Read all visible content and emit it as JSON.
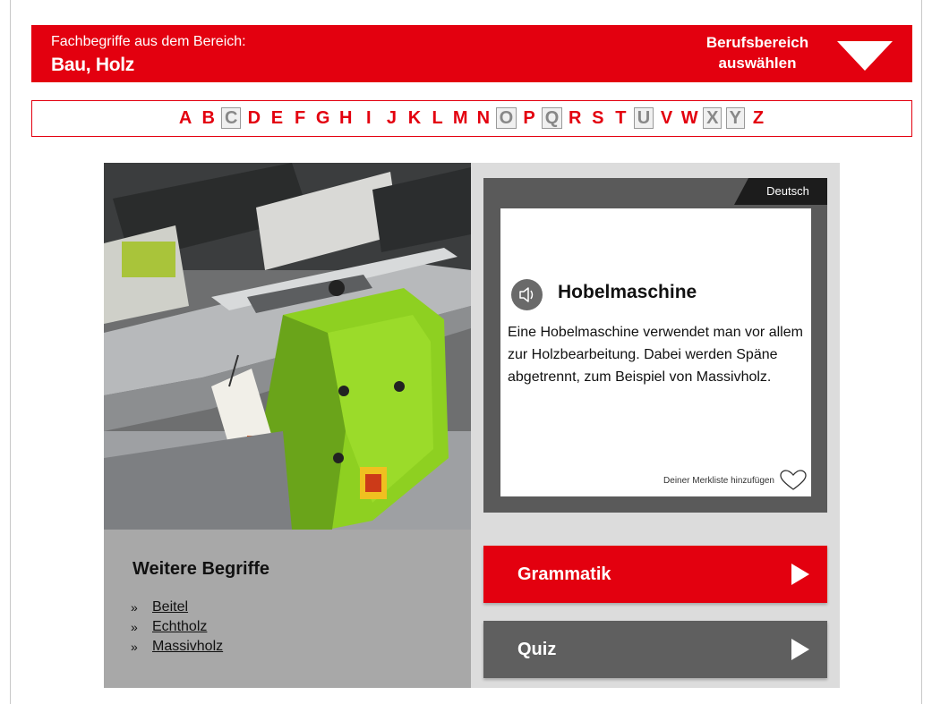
{
  "header": {
    "subtitle": "Fachbegriffe aus dem Bereich:",
    "area": "Bau, Holz",
    "select_line1": "Berufsbereich",
    "select_line2": "auswählen",
    "accent_color": "#e3000f"
  },
  "alphabet": {
    "letters": [
      "A",
      "B",
      "C",
      "D",
      "E",
      "F",
      "G",
      "H",
      "I",
      "J",
      "K",
      "L",
      "M",
      "N",
      "O",
      "P",
      "Q",
      "R",
      "S",
      "T",
      "U",
      "V",
      "W",
      "X",
      "Y",
      "Z"
    ],
    "disabled": [
      "C",
      "O",
      "Q",
      "U",
      "X",
      "Y"
    ]
  },
  "card": {
    "language": "Deutsch",
    "term": "Hobelmaschine",
    "definition": "Eine Hobelmaschine verwendet man vor allem zur Holzbearbeitung. Dabei werden Späne abgetrennt, zum Beispiel von Massivholz.",
    "favorite_label": "Deiner Merkliste hinzufügen",
    "speaker_icon": "speaker-icon",
    "favorite_icon": "heart-icon"
  },
  "more": {
    "title": "Weitere Begriffe",
    "bullet": "»",
    "items": [
      "Beitel",
      "Echtholz",
      "Massivholz"
    ]
  },
  "buttons": {
    "grammar": "Grammatik",
    "quiz": "Quiz"
  }
}
